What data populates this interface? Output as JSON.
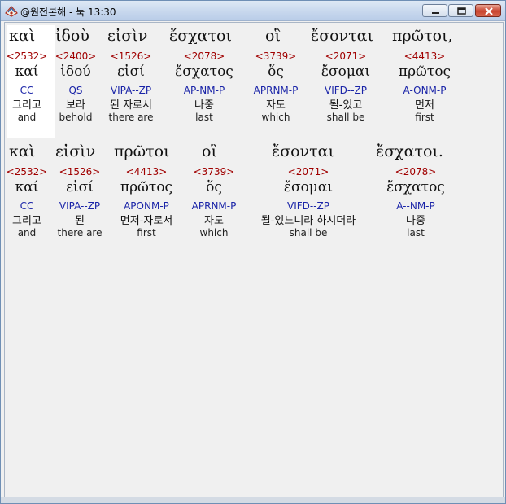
{
  "window": {
    "title": "@원전본해 - 눅 13:30",
    "colors": {
      "strong": "#a00000",
      "morph": "#1a24a8",
      "title_bg": "#c9d9ee"
    }
  },
  "rows": [
    {
      "greek": [
        "καὶ",
        "ἰδοὺ",
        "εἰσὶν",
        "ἔσχατοι",
        "οἳ",
        "ἔσονται",
        "πρῶτοι,"
      ],
      "words": [
        {
          "strong": "<2532>",
          "lemma": "καί",
          "morph": "CC",
          "kor": "그리고",
          "eng": "and"
        },
        {
          "strong": "<2400>",
          "lemma": "ἰδού",
          "morph": "QS",
          "kor": "보라",
          "eng": "behold"
        },
        {
          "strong": "<1526>",
          "lemma": "εἰσί",
          "morph": "VIPA--ZP",
          "kor": "된 자로서",
          "eng": "there are"
        },
        {
          "strong": "<2078>",
          "lemma": "ἔσχατος",
          "morph": "AP-NM-P",
          "kor": "나중",
          "eng": "last"
        },
        {
          "strong": "<3739>",
          "lemma": "ὅς",
          "morph": "APRNM-P",
          "kor": "자도",
          "eng": "which"
        },
        {
          "strong": "<2071>",
          "lemma": "ἔσομαι",
          "morph": "VIFD--ZP",
          "kor": "될-있고",
          "eng": "shall be"
        },
        {
          "strong": "<4413>",
          "lemma": "πρῶτος",
          "morph": "A-ONM-P",
          "kor": "먼저",
          "eng": "first"
        }
      ]
    },
    {
      "greek": [
        "καὶ",
        "εἰσὶν",
        "πρῶτοι",
        "οἳ",
        "ἔσονται",
        "ἔσχατοι."
      ],
      "words": [
        {
          "strong": "<2532>",
          "lemma": "καί",
          "morph": "CC",
          "kor": "그리고",
          "eng": "and"
        },
        {
          "strong": "<1526>",
          "lemma": "εἰσί",
          "morph": "VIPA--ZP",
          "kor": "된",
          "eng": "there are"
        },
        {
          "strong": "<4413>",
          "lemma": "πρῶτος",
          "morph": "APONM-P",
          "kor": "먼저-자로서",
          "eng": "first"
        },
        {
          "strong": "<3739>",
          "lemma": "ὅς",
          "morph": "APRNM-P",
          "kor": "자도",
          "eng": "which"
        },
        {
          "strong": "<2071>",
          "lemma": "ἔσομαι",
          "morph": "VIFD--ZP",
          "kor": "될-있느니라 하시더라",
          "eng": "shall be"
        },
        {
          "strong": "<2078>",
          "lemma": "ἔσχατος",
          "morph": "A--NM-P",
          "kor": "나중",
          "eng": "last"
        }
      ]
    }
  ]
}
